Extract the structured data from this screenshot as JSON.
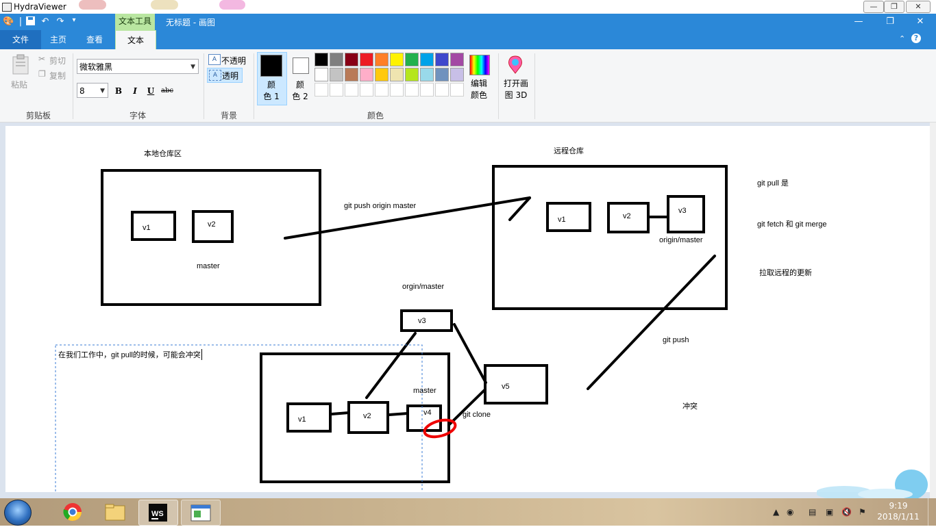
{
  "viewer": {
    "title": "HydraViewer"
  },
  "paint": {
    "document_title": "无标题 - 画图",
    "context_tab": "文本工具"
  },
  "tabs": [
    "文件",
    "主页",
    "查看",
    "文本"
  ],
  "ribbon": {
    "clipboard": {
      "paste": "粘贴",
      "cut": "剪切",
      "copy": "复制",
      "label": "剪贴板"
    },
    "font": {
      "family": "微软雅黑",
      "size": "8",
      "bold": "B",
      "italic": "I",
      "underline": "U",
      "strike": "abc",
      "label": "字体"
    },
    "background": {
      "opaque": "不透明",
      "transparent": "透明",
      "label": "背景"
    },
    "colors": {
      "color1": "颜\n色 1",
      "color2": "颜\n色 2",
      "edit": "编辑\n颜色",
      "label": "颜色",
      "color1_value": "#000000",
      "color2_value": "#ffffff",
      "palette_row1": [
        "#000000",
        "#7f7f7f",
        "#880015",
        "#ed1c24",
        "#ff7f27",
        "#fff200",
        "#22b14c",
        "#00a2e8",
        "#3f48cc",
        "#a349a4"
      ],
      "palette_row2": [
        "#ffffff",
        "#c3c3c3",
        "#b97a57",
        "#ffaec9",
        "#ffc90e",
        "#efe4b0",
        "#b5e61d",
        "#99d9ea",
        "#7092be",
        "#c8bfe7"
      ]
    },
    "paint3d": "打开画\n图 3D"
  },
  "canvas": {
    "local_repo_title": "本地仓库区",
    "remote_repo_title": "远程仓库",
    "push_label": "git push origin master",
    "git_pull_is": "git pull 是",
    "git_fetch_merge": "git fetch 和  git merge",
    "pull_remote_updates": "拉取远程的更新",
    "origin_master_remote": "origin/master",
    "origin_master_mid": "orgin/master",
    "git_push": "git push",
    "git_clone": "git clone",
    "conflict": "冲突",
    "master_local": "master",
    "master_clone": "master",
    "note_text": "在我们工作中，git pull的时候，可能会冲突",
    "local_v1": "v1",
    "local_v2": "v2",
    "remote_v1": "v1",
    "remote_v2": "v2",
    "remote_v3": "v3",
    "mid_v3": "v3",
    "v5": "v5",
    "clone_v1": "v1",
    "clone_v2": "v2",
    "clone_v4": "v4"
  },
  "taskbar": {
    "time": "9:19",
    "date": "2018/1/11"
  }
}
